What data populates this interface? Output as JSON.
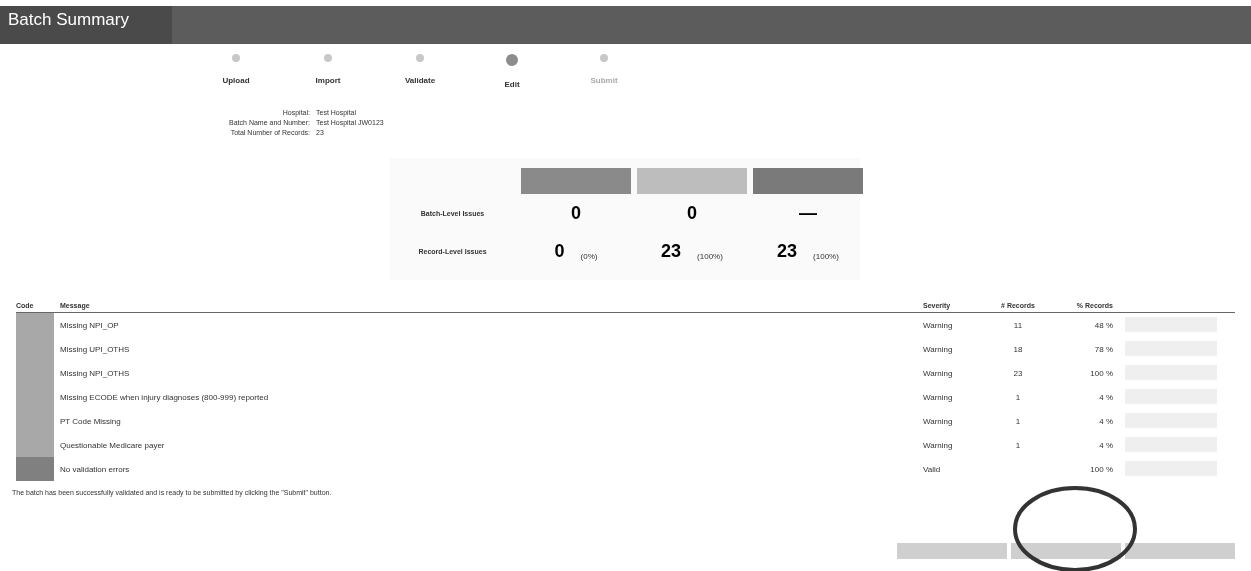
{
  "header": {
    "title": "Batch Summary"
  },
  "steps": [
    {
      "label": "Upload",
      "selected": false,
      "disabled": false
    },
    {
      "label": "Import",
      "selected": false,
      "disabled": false
    },
    {
      "label": "Validate",
      "selected": false,
      "disabled": false
    },
    {
      "label": "Edit",
      "selected": true,
      "disabled": false
    },
    {
      "label": "Submit",
      "selected": false,
      "disabled": true
    }
  ],
  "batch_info": [
    {
      "label": "Hospital:",
      "value": "Test Hospital"
    },
    {
      "label": "Batch Name and Number:",
      "value": "Test Hospital JW0123"
    },
    {
      "label": "Total Number of Records:",
      "value": "23"
    }
  ],
  "summary": {
    "columns": [
      {
        "color": "#8a8a8a"
      },
      {
        "color": "#bdbdbd"
      },
      {
        "color": "#7a7a7a"
      }
    ],
    "rows": [
      {
        "label": "Batch-Level Issues",
        "cells": [
          {
            "value": "0"
          },
          {
            "value": "0"
          },
          {
            "value": "—"
          }
        ]
      },
      {
        "label": "Record-Level Issues",
        "cells": [
          {
            "value": "0",
            "note": "(0%)"
          },
          {
            "value": "23",
            "note": "(100%)"
          },
          {
            "value": "23",
            "note": "(100%)"
          }
        ]
      }
    ]
  },
  "issues": {
    "columns": [
      "Code",
      "Message",
      "Severity",
      "# Records",
      "% Records"
    ],
    "rows": [
      {
        "message": "Missing NPI_OP",
        "severity": "Warning",
        "records": "11",
        "percent": "48 %",
        "kind": "issue"
      },
      {
        "message": "Missing UPI_OTHS",
        "severity": "Warning",
        "records": "18",
        "percent": "78 %",
        "kind": "issue"
      },
      {
        "message": "Missing NPI_OTHS",
        "severity": "Warning",
        "records": "23",
        "percent": "100 %",
        "kind": "issue"
      },
      {
        "message": "Missing ECODE when injury diagnoses (800-999) reported",
        "severity": "Warning",
        "records": "1",
        "percent": "4 %",
        "kind": "issue"
      },
      {
        "message": "PT Code Missing",
        "severity": "Warning",
        "records": "1",
        "percent": "4 %",
        "kind": "issue"
      },
      {
        "message": "Questionable Medicare payer",
        "severity": "Warning",
        "records": "1",
        "percent": "4 %",
        "kind": "issue"
      },
      {
        "message": "No validation errors",
        "severity": "Valid",
        "percent": "100 %",
        "kind": "valid"
      }
    ]
  },
  "status_message": "The batch has been successfully validated and is ready to be submitted by clicking the \"Submit\" button."
}
